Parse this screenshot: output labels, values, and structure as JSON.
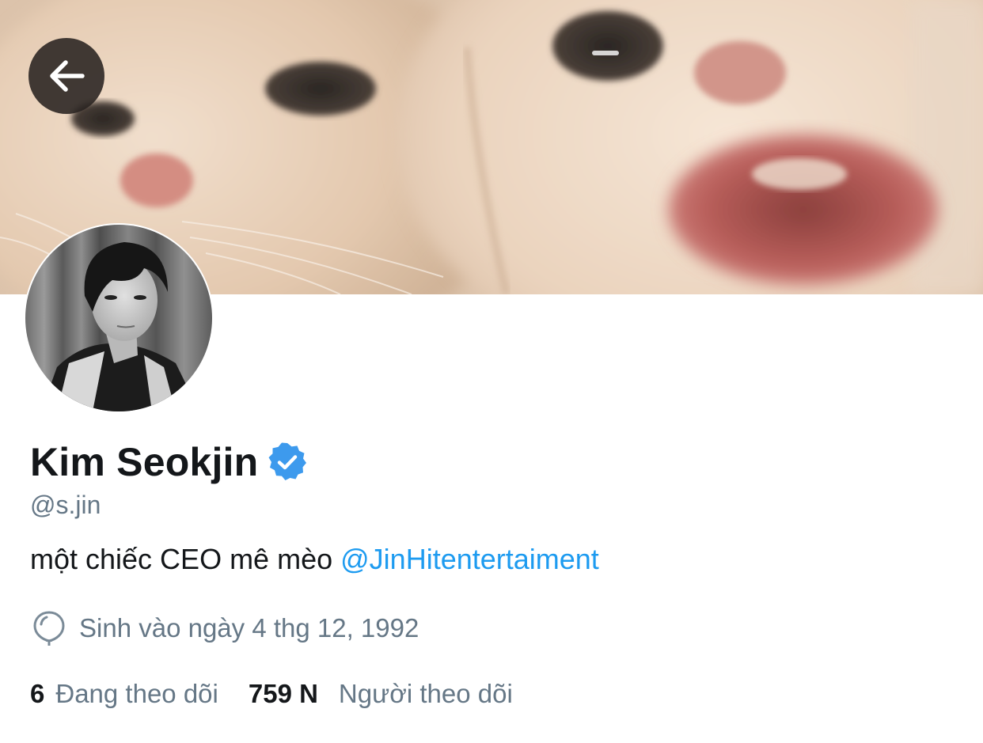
{
  "profile": {
    "display_name": "Kim Seokjin",
    "handle": "@s.jin",
    "bio_text": "một chiếc CEO mê mèo",
    "bio_mention": "@JinHitentertaiment",
    "birthday": "Sinh vào ngày 4 thg 12, 1992",
    "verified": true
  },
  "stats": {
    "following_count": "6",
    "following_label": "Đang theo dõi",
    "followers_count": "759 N",
    "followers_label": "Người theo dõi"
  },
  "icons": {
    "back": "arrow-left-icon",
    "verified": "verified-badge-icon",
    "birthday": "balloon-icon"
  },
  "colors": {
    "accent": "#1d9bf0",
    "text_primary": "#14171a",
    "text_secondary": "#657786",
    "verified_badge": "#3d9aed"
  }
}
